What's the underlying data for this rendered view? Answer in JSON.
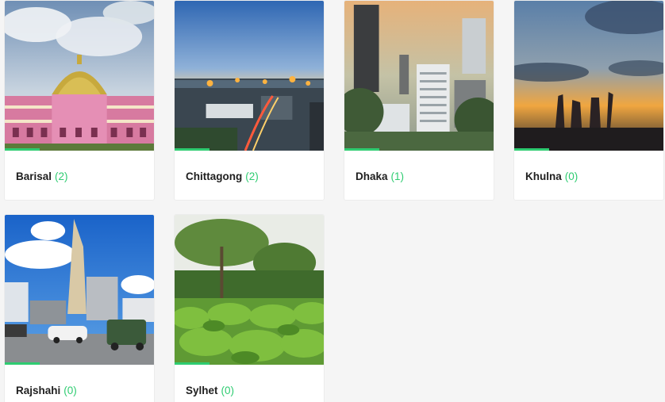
{
  "accent_color": "#2ecc71",
  "cities": [
    {
      "name": "Barisal",
      "count": "(2)",
      "image": "barisal-mosque-photo"
    },
    {
      "name": "Chittagong",
      "count": "(2)",
      "image": "chittagong-port-night-photo"
    },
    {
      "name": "Dhaka",
      "count": "(1)",
      "image": "dhaka-skyline-photo"
    },
    {
      "name": "Khulna",
      "count": "(0)",
      "image": "khulna-monument-sunset-photo"
    },
    {
      "name": "Rajshahi",
      "count": "(0)",
      "image": "rajshahi-tower-street-photo"
    },
    {
      "name": "Sylhet",
      "count": "(0)",
      "image": "sylhet-tea-garden-photo"
    }
  ]
}
